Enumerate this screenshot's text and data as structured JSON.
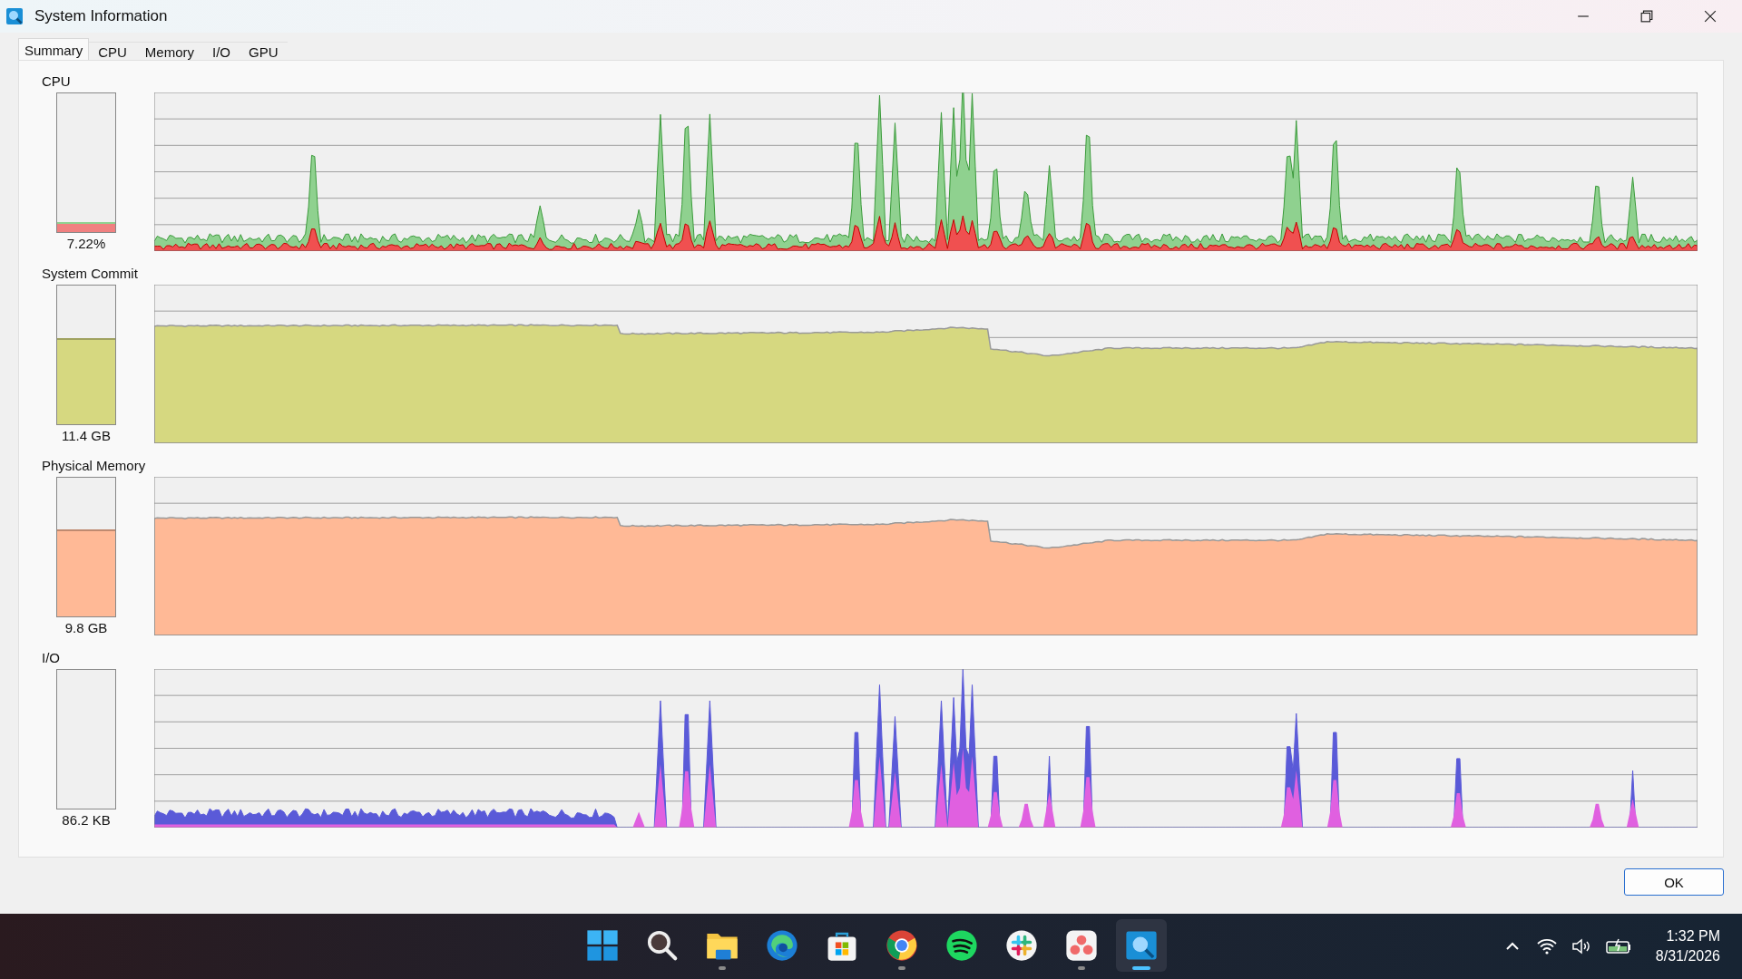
{
  "window": {
    "title": "System Information"
  },
  "tabs": [
    {
      "label": "Summary",
      "selected": true
    },
    {
      "label": "CPU",
      "selected": false
    },
    {
      "label": "Memory",
      "selected": false
    },
    {
      "label": "I/O",
      "selected": false
    },
    {
      "label": "GPU",
      "selected": false
    }
  ],
  "panels": [
    {
      "label": "CPU",
      "kind": "cpu",
      "color": "#8fd18f",
      "level": 0.07,
      "reading": "7.22%"
    },
    {
      "label": "System Commit",
      "kind": "steady",
      "color": "#d6d880",
      "level": 0.62,
      "reading": "11.4 GB"
    },
    {
      "label": "Physical Memory",
      "kind": "steady",
      "color": "#ffb996",
      "level": 0.63,
      "reading": "9.8 GB"
    },
    {
      "label": "I/O",
      "kind": "io",
      "color": "#5a5ad8",
      "level": 0,
      "reading": "86.2 KB"
    }
  ],
  "buttons": [
    "OK"
  ],
  "taskbar": {
    "apps": [
      {
        "kind": "start",
        "running": false,
        "selected": false
      },
      {
        "kind": "search",
        "running": false,
        "selected": false
      },
      {
        "kind": "folder",
        "running": true,
        "selected": false
      },
      {
        "kind": "edge",
        "running": false,
        "selected": false
      },
      {
        "kind": "store",
        "running": false,
        "selected": false
      },
      {
        "kind": "chrome",
        "running": true,
        "selected": false
      },
      {
        "kind": "spotify",
        "running": false,
        "selected": false
      },
      {
        "kind": "slack",
        "running": false,
        "selected": false
      },
      {
        "kind": "asana",
        "running": true,
        "selected": false
      },
      {
        "kind": "sysinfo",
        "running": true,
        "selected": true
      }
    ],
    "time": "1:32 PM",
    "date": "8/31/2026"
  }
}
